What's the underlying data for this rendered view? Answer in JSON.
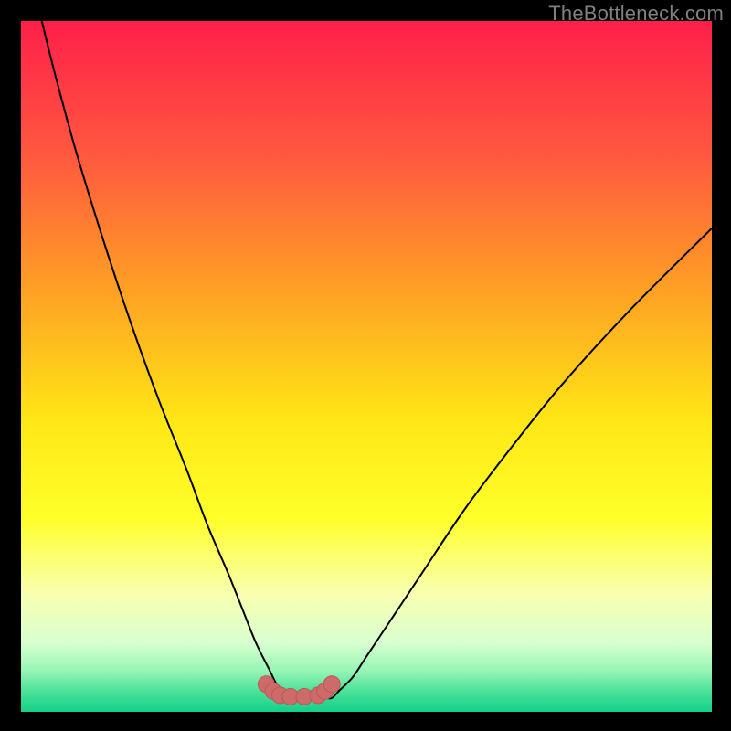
{
  "attribution": "TheBottleneck.com",
  "chart_data": {
    "type": "line",
    "title": "",
    "xlabel": "",
    "ylabel": "",
    "xlim": [
      0,
      100
    ],
    "ylim": [
      0,
      100
    ],
    "grid": false,
    "legend": false,
    "series": [
      {
        "name": "bottleneck-curve",
        "x": [
          3,
          5,
          8,
          12,
          16,
          20,
          24,
          27,
          30,
          32,
          34,
          36,
          37,
          38,
          39,
          40,
          41,
          42,
          43,
          44,
          45,
          46,
          48,
          50,
          54,
          58,
          64,
          70,
          78,
          88,
          100
        ],
        "y": [
          100,
          92,
          81,
          68,
          56,
          45,
          35,
          27,
          20,
          15,
          10,
          6,
          4,
          3,
          2,
          2,
          2,
          2,
          2,
          2,
          2,
          3,
          5,
          8,
          14,
          20,
          29,
          37,
          47,
          58,
          70
        ]
      },
      {
        "name": "bottom-band-dots",
        "x": [
          35.5,
          36.5,
          37.5,
          39,
          41,
          43,
          44,
          45
        ],
        "y": [
          4.0,
          3.0,
          2.4,
          2.2,
          2.2,
          2.4,
          3.0,
          4.0
        ]
      }
    ],
    "background_gradient": {
      "type": "vertical",
      "stops": [
        {
          "pos": 0.0,
          "color": "#ff1f4a"
        },
        {
          "pos": 0.2,
          "color": "#ff5a3e"
        },
        {
          "pos": 0.4,
          "color": "#ffa423"
        },
        {
          "pos": 0.58,
          "color": "#ffe715"
        },
        {
          "pos": 0.72,
          "color": "#ffff2a"
        },
        {
          "pos": 0.83,
          "color": "#f8ffb0"
        },
        {
          "pos": 0.9,
          "color": "#d8ffd0"
        },
        {
          "pos": 0.94,
          "color": "#98f5b6"
        },
        {
          "pos": 0.97,
          "color": "#4be29a"
        },
        {
          "pos": 1.0,
          "color": "#12d18a"
        }
      ]
    },
    "curve_style": {
      "stroke": "#000000",
      "stroke_width": 2
    },
    "dot_style": {
      "fill": "#cf6a6a",
      "radius": 9,
      "outline": "#b85a5a"
    }
  }
}
